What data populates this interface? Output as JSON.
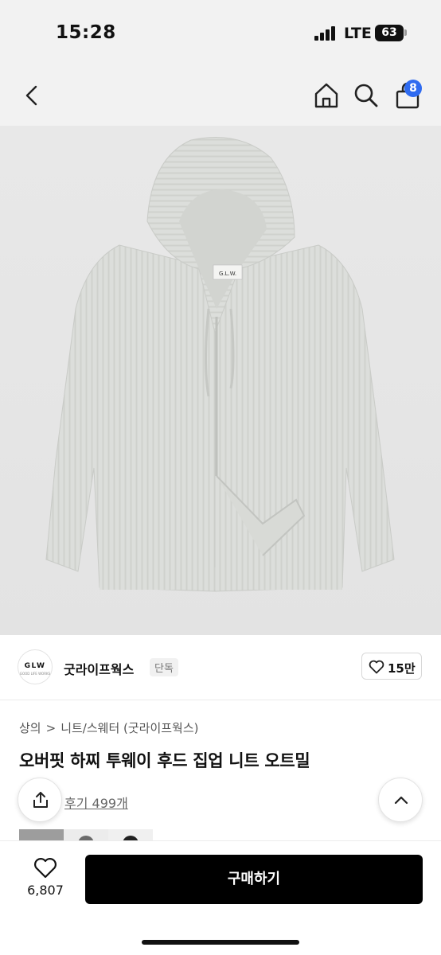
{
  "status_bar": {
    "time": "15:28",
    "network": "LTE",
    "battery": "63"
  },
  "nav": {
    "cart_badge": "8",
    "icons": [
      "back-icon",
      "home-icon",
      "search-icon",
      "shopping-bag-icon"
    ]
  },
  "product_image": {
    "logo_text": "G.L.W."
  },
  "brand": {
    "logo_text": "GLW",
    "logo_subtext": "GOOD LIFE WORKS",
    "name": "굿라이프웍스",
    "tag": "단독",
    "likes": "15만"
  },
  "product": {
    "breadcrumb": [
      "상의",
      "니트/스웨터 (굿라이프웍스)"
    ],
    "breadcrumb_separator": ">",
    "title": "오버핏 하찌 투웨이 후드 집업 니트 오트밀",
    "reviews": "후기 499개"
  },
  "bottom_bar": {
    "wish_count": "6,807",
    "buy_label": "구매하기"
  },
  "colors": {
    "accent": "#2f6bf0",
    "buy_button": "#000000",
    "background_top": "#f2f2f2"
  }
}
